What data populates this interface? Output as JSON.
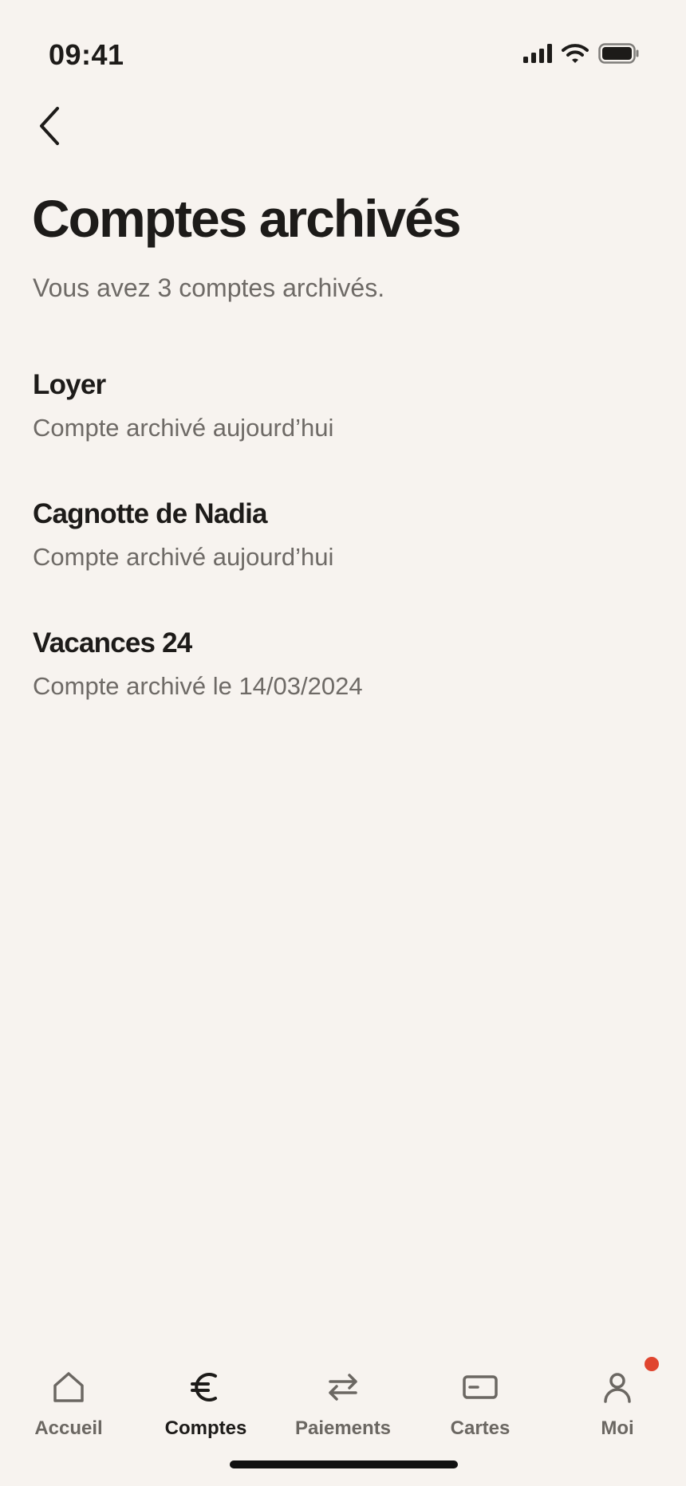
{
  "status_bar": {
    "time": "09:41",
    "icons": [
      "signal-icon",
      "wifi-icon",
      "battery-icon"
    ]
  },
  "header": {
    "back_icon": "chevron-left-icon",
    "title": "Comptes archivés",
    "subtitle": "Vous avez 3 comptes archivés."
  },
  "accounts": [
    {
      "name": "Loyer",
      "meta": "Compte archivé aujourd’hui"
    },
    {
      "name": "Cagnotte de Nadia",
      "meta": "Compte archivé aujourd’hui"
    },
    {
      "name": "Vacances 24",
      "meta": "Compte archivé le 14/03/2024"
    }
  ],
  "tab_bar": {
    "tabs": [
      {
        "label": "Accueil",
        "icon": "home-icon",
        "active": false
      },
      {
        "label": "Comptes",
        "icon": "euro-icon",
        "active": true
      },
      {
        "label": "Paiements",
        "icon": "transfer-arrows-icon",
        "active": false
      },
      {
        "label": "Cartes",
        "icon": "card-icon",
        "active": false
      },
      {
        "label": "Moi",
        "icon": "user-icon",
        "active": false,
        "badge": true
      }
    ]
  },
  "colors": {
    "background": "#f7f3ef",
    "text_primary": "#1d1b19",
    "text_secondary": "#6e6a66",
    "badge": "#e0452f"
  }
}
